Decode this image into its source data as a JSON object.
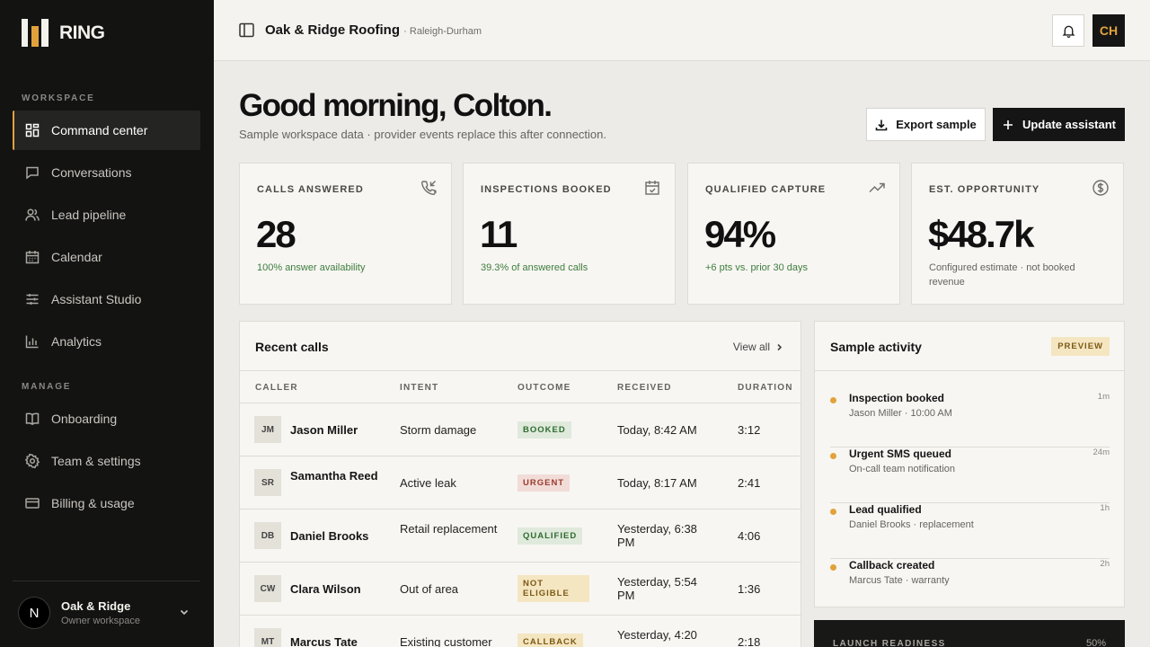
{
  "brand": {
    "name": "RING"
  },
  "sidebar": {
    "workspace_label": "WORKSPACE",
    "workspace_items": [
      {
        "label": "Command center",
        "icon": "grid-icon",
        "active": true
      },
      {
        "label": "Conversations",
        "icon": "chat-icon"
      },
      {
        "label": "Lead pipeline",
        "icon": "users-icon"
      },
      {
        "label": "Calendar",
        "icon": "calendar-icon"
      },
      {
        "label": "Assistant Studio",
        "icon": "sliders-icon"
      },
      {
        "label": "Analytics",
        "icon": "bar-chart-icon"
      }
    ],
    "manage_label": "MANAGE",
    "manage_items": [
      {
        "label": "Onboarding",
        "icon": "book-icon"
      },
      {
        "label": "Team & settings",
        "icon": "gear-icon"
      },
      {
        "label": "Billing & usage",
        "icon": "credit-card-icon"
      }
    ],
    "workspace_switch": {
      "avatar": "N",
      "name": "Oak & Ridge",
      "sub": "Owner workspace"
    }
  },
  "topbar": {
    "org_name": "Oak & Ridge Roofing",
    "org_location": "· Raleigh-Durham",
    "user_initials": "CH"
  },
  "greeting": {
    "title": "Good morning, Colton.",
    "subtitle": "Sample workspace data · provider events replace this after connection."
  },
  "actions": {
    "export_label": "Export sample",
    "update_label": "Update assistant"
  },
  "stats": [
    {
      "label": "CALLS ANSWERED",
      "value": "28",
      "note": "100% answer availability",
      "icon": "phone-incoming-icon"
    },
    {
      "label": "INSPECTIONS BOOKED",
      "value": "11",
      "note": "39.3% of answered calls",
      "icon": "calendar-check-icon"
    },
    {
      "label": "QUALIFIED CAPTURE",
      "value": "94%",
      "note": "+6 pts vs. prior 30 days",
      "icon": "trending-up-icon"
    },
    {
      "label": "EST. OPPORTUNITY",
      "value": "$48.7k",
      "note": "Configured estimate · not booked revenue",
      "icon": "dollar-circle-icon"
    }
  ],
  "calls": {
    "title": "Recent calls",
    "view_all": "View all",
    "columns": [
      "CALLER",
      "INTENT",
      "OUTCOME",
      "RECEIVED",
      "DURATION"
    ],
    "rows": [
      {
        "initials": "JM",
        "caller": "Jason Miller",
        "intent": "Storm damage",
        "outcome": "BOOKED",
        "received": "Today, 8:42 AM",
        "duration": "3:12"
      },
      {
        "initials": "SR",
        "caller": "Samantha Reed",
        "intent": "Active leak",
        "outcome": "URGENT",
        "received": "Today, 8:17 AM",
        "duration": "2:41"
      },
      {
        "initials": "DB",
        "caller": "Daniel Brooks",
        "intent": "Retail replacement",
        "outcome": "QUALIFIED",
        "received": "Yesterday, 6:38 PM",
        "duration": "4:06"
      },
      {
        "initials": "CW",
        "caller": "Clara Wilson",
        "intent": "Out of area",
        "outcome": "NOT ELIGIBLE",
        "received": "Yesterday, 5:54 PM",
        "duration": "1:36"
      },
      {
        "initials": "MT",
        "caller": "Marcus Tate",
        "intent": "Existing customer",
        "outcome": "CALLBACK",
        "received": "Yesterday, 4:20",
        "duration": "2:18"
      }
    ]
  },
  "activity": {
    "title": "Sample activity",
    "badge": "PREVIEW",
    "items": [
      {
        "title": "Inspection booked",
        "sub": "Jason Miller · 10:00 AM",
        "time": "1m"
      },
      {
        "title": "Urgent SMS queued",
        "sub": "On-call team notification",
        "time": "24m"
      },
      {
        "title": "Lead qualified",
        "sub": "Daniel Brooks · replacement",
        "time": "1h"
      },
      {
        "title": "Callback created",
        "sub": "Marcus Tate · warranty",
        "time": "2h"
      }
    ]
  },
  "launch": {
    "label": "LAUNCH READINESS",
    "percent": "50%"
  },
  "colors": {
    "accent": "#e2a23b",
    "sidebar_bg": "#131312",
    "success": "#3e7d3e",
    "danger": "#9a3b2c"
  }
}
